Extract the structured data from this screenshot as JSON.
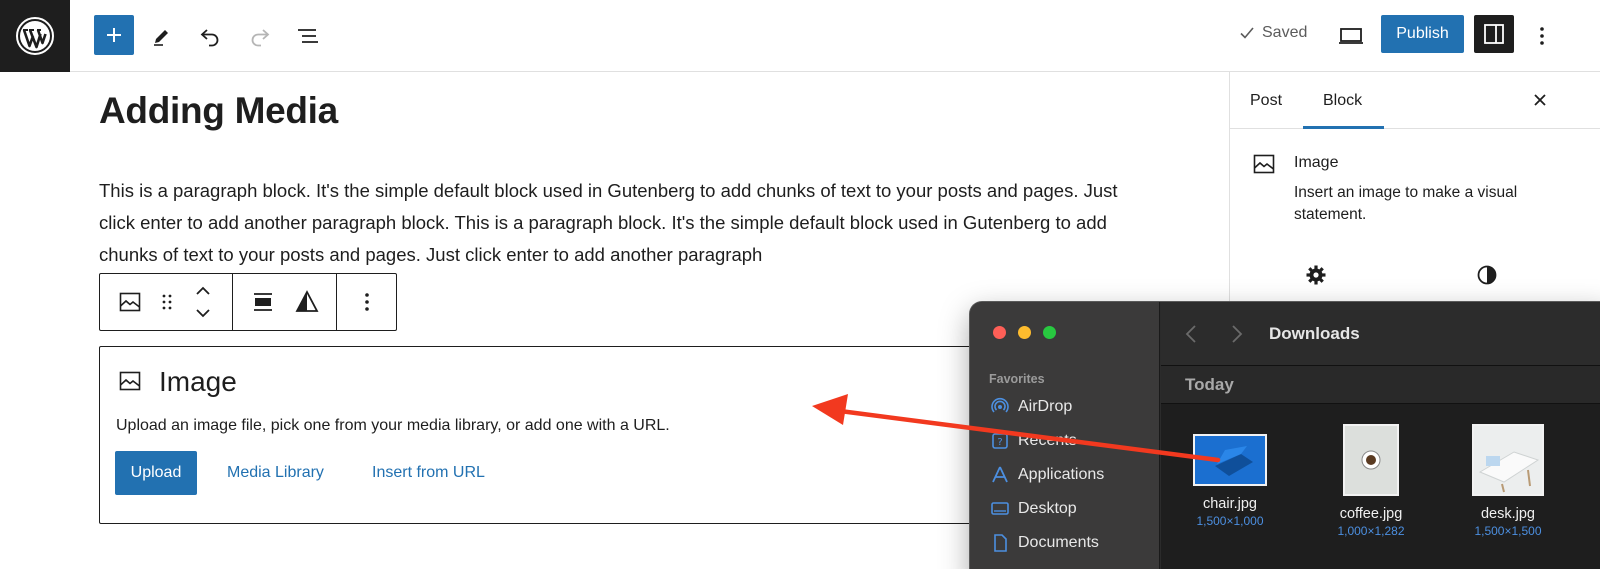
{
  "toolbar": {
    "saved_label": "Saved",
    "publish_label": "Publish"
  },
  "post": {
    "title": "Adding Media",
    "paragraph": "This is a paragraph block. It's the simple default block used in Gutenberg to add chunks of text to your posts and pages. Just click enter to add another paragraph block. This is a paragraph block. It's the simple default block used in Gutenberg to add chunks of text to your posts and pages. Just click enter to add another paragraph"
  },
  "image_block": {
    "title": "Image",
    "description": "Upload an image file, pick one from your media library, or add one with a URL.",
    "upload_label": "Upload",
    "media_library_label": "Media Library",
    "insert_url_label": "Insert from URL"
  },
  "sidebar": {
    "tabs": [
      {
        "label": "Post"
      },
      {
        "label": "Block"
      }
    ],
    "block_name": "Image",
    "block_description": "Insert an image to make a visual statement."
  },
  "finder": {
    "location": "Downloads",
    "section_label": "Today",
    "favorites_label": "Favorites",
    "sidebar_items": [
      {
        "label": "AirDrop",
        "icon": "airdrop-icon"
      },
      {
        "label": "Recents",
        "icon": "recents-icon"
      },
      {
        "label": "Applications",
        "icon": "applications-icon"
      },
      {
        "label": "Desktop",
        "icon": "desktop-icon"
      },
      {
        "label": "Documents",
        "icon": "documents-icon"
      }
    ],
    "files": [
      {
        "name": "chair.jpg",
        "dimensions": "1,500×1,000"
      },
      {
        "name": "coffee.jpg",
        "dimensions": "1,000×1,282"
      },
      {
        "name": "desk.jpg",
        "dimensions": "1,500×1,500"
      }
    ]
  },
  "colors": {
    "accent": "#2271b1",
    "arrow": "#f2391f",
    "dark": "#1e1e1e"
  }
}
